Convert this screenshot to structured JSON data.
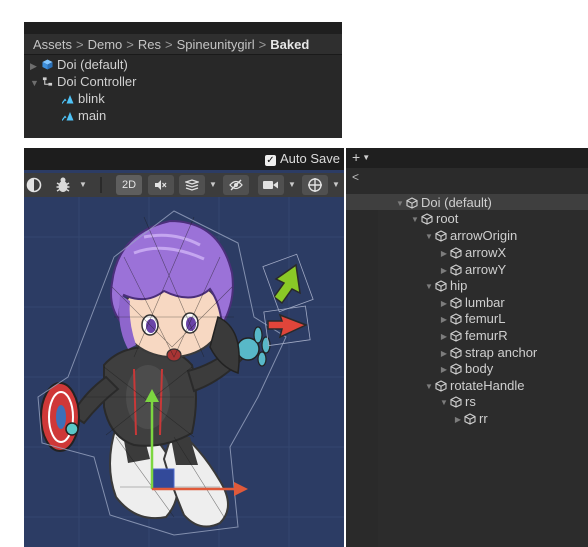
{
  "project": {
    "breadcrumb": [
      "Assets",
      "Demo",
      "Res",
      "Spineunitygirl",
      "Baked"
    ],
    "separator": ">",
    "items": [
      {
        "label": "Doi (default)",
        "expanded": false
      },
      {
        "label": "Doi Controller",
        "expanded": true
      },
      {
        "label": "blink"
      },
      {
        "label": "main"
      }
    ]
  },
  "scene": {
    "auto_save_label": "Auto Save",
    "auto_save_checked": true,
    "toolbar": {
      "mode_2d_label": "2D",
      "icons": [
        "render-mode-icon",
        "debug-icon",
        "audio-icon",
        "effects-icon",
        "visibility-icon",
        "camera-icon",
        "gizmos-icon"
      ]
    }
  },
  "hierarchy": {
    "add_label": "+",
    "back_label": "<",
    "nodes": [
      {
        "label": "Doi (default)",
        "state": "expanded",
        "selected": true
      },
      {
        "label": "root",
        "state": "expanded"
      },
      {
        "label": "arrowOrigin",
        "state": "expanded"
      },
      {
        "label": "arrowX",
        "state": "collapsed"
      },
      {
        "label": "arrowY",
        "state": "collapsed"
      },
      {
        "label": "hip",
        "state": "expanded"
      },
      {
        "label": "lumbar",
        "state": "collapsed"
      },
      {
        "label": "femurL",
        "state": "collapsed"
      },
      {
        "label": "femurR",
        "state": "collapsed"
      },
      {
        "label": "strap anchor",
        "state": "collapsed"
      },
      {
        "label": "body",
        "state": "collapsed"
      },
      {
        "label": "rotateHandle",
        "state": "expanded"
      },
      {
        "label": "rs",
        "state": "expanded"
      },
      {
        "label": "rr",
        "state": "collapsed"
      }
    ]
  },
  "colors": {
    "scene_background": "#2c3c64",
    "panel_background": "#282828",
    "hair": "#9b72d8",
    "arrow_green": "#8ac926",
    "arrow_red": "#e0453a",
    "gizmo_green": "#7cd641",
    "gizmo_red": "#e05a3a"
  }
}
